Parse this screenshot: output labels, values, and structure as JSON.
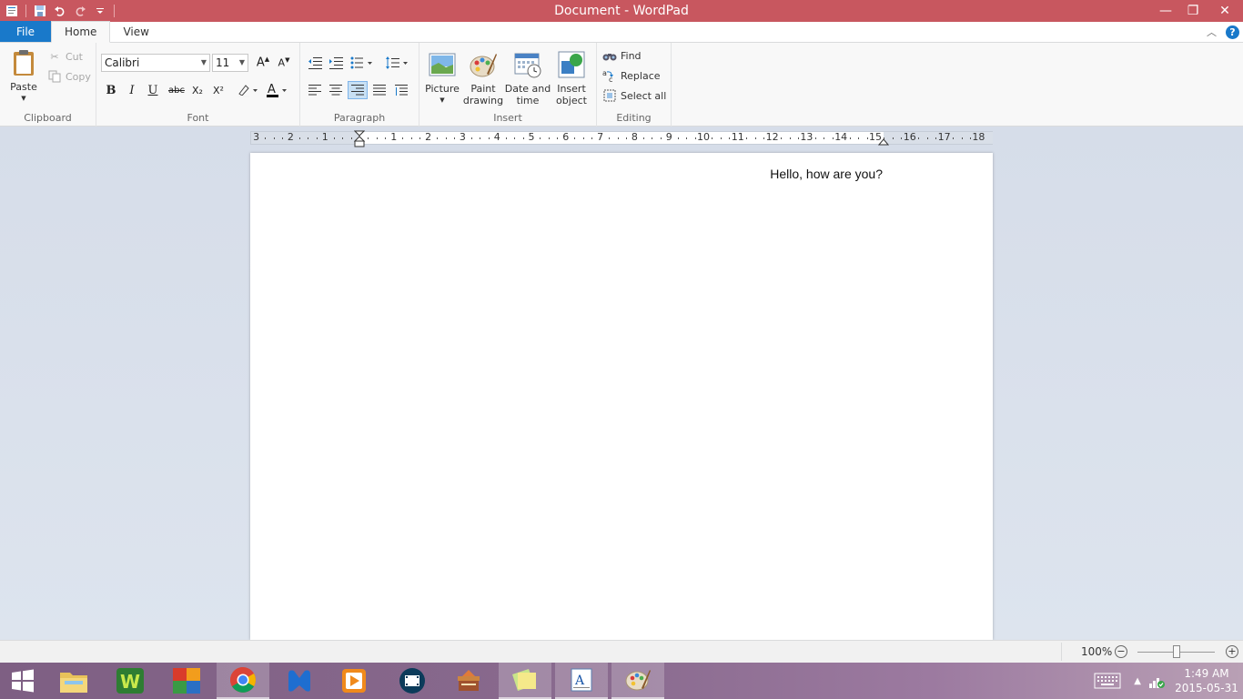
{
  "window": {
    "title": "Document - WordPad",
    "minimize_glyph": "—",
    "restore_glyph": "❐",
    "close_glyph": "✕"
  },
  "tabs": {
    "file": "File",
    "home": "Home",
    "view": "View"
  },
  "ribbon": {
    "clipboard": {
      "label": "Clipboard",
      "paste": "Paste",
      "cut": "Cut",
      "copy": "Copy"
    },
    "font": {
      "label": "Font",
      "family": "Calibri",
      "size": "11",
      "bold": "B",
      "italic": "I",
      "underline": "U",
      "strike": "abc",
      "subscript": "X₂",
      "superscript": "X²"
    },
    "paragraph": {
      "label": "Paragraph"
    },
    "insert": {
      "label": "Insert",
      "picture": "Picture",
      "paint_drawing_1": "Paint",
      "paint_drawing_2": "drawing",
      "date_time_1": "Date and",
      "date_time_2": "time",
      "insert_object_1": "Insert",
      "insert_object_2": "object"
    },
    "editing": {
      "label": "Editing",
      "find": "Find",
      "replace": "Replace",
      "select_all": "Select all"
    }
  },
  "ruler": {
    "left_numbers": [
      "3",
      "2",
      "1"
    ],
    "numbers": [
      "1",
      "2",
      "3",
      "4",
      "5",
      "6",
      "7",
      "8",
      "9",
      "10",
      "11",
      "12",
      "13",
      "14",
      "15",
      "16",
      "17",
      "18"
    ]
  },
  "document": {
    "text": "Hello, how are you?",
    "alignment": "right"
  },
  "status": {
    "zoom": "100%",
    "zoom_level_percent": 100,
    "minus": "−",
    "plus": "+"
  },
  "taskbar": {
    "time": "1:49 AM",
    "date": "2015-05-31"
  },
  "colors": {
    "titlebar": "#c8575f",
    "file_tab": "#1979ca",
    "ribbon": "#f8f8f8"
  }
}
